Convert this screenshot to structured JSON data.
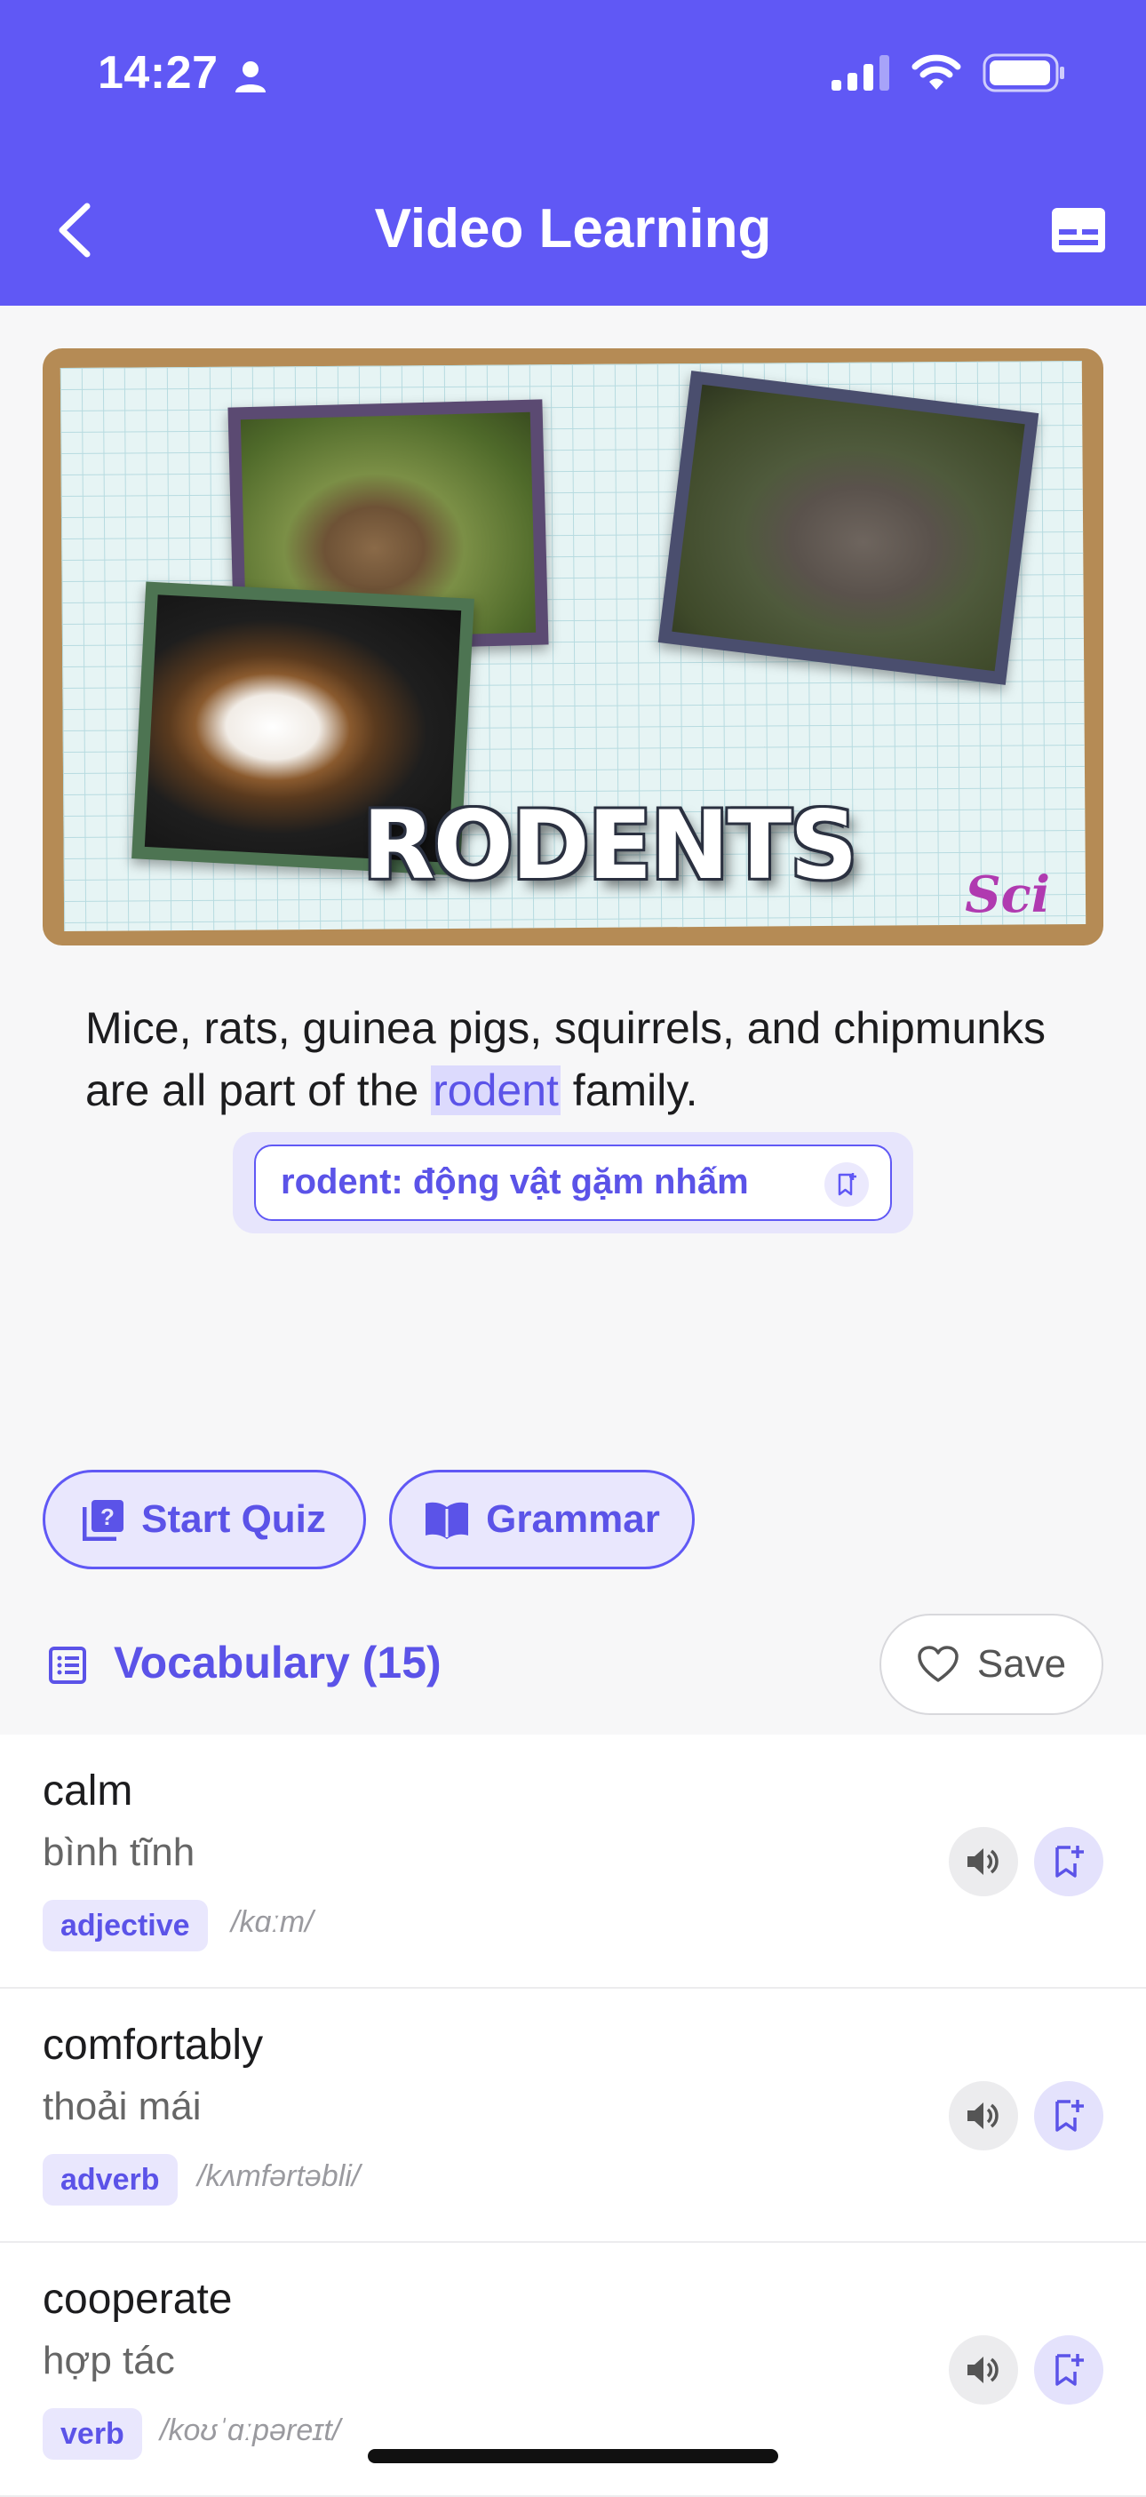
{
  "status": {
    "time": "14:27"
  },
  "header": {
    "title": "Video Learning"
  },
  "video": {
    "title": "RODENTS",
    "logo": "Sci"
  },
  "subtitle": {
    "before": "Mice, rats, guinea pigs, squirrels, and chipmunks are all part of the ",
    "highlight": "rodent",
    "after": " family."
  },
  "translation": {
    "text": "rodent: động vật gặm nhấm"
  },
  "actions": {
    "quiz_label": "Start Quiz",
    "grammar_label": "Grammar"
  },
  "vocabulary": {
    "title": "Vocabulary (15)",
    "save_label": "Save",
    "items": [
      {
        "word": "calm",
        "meaning": "bình tĩnh",
        "pos": "adjective",
        "ipa": "/kɑːm/"
      },
      {
        "word": "comfortably",
        "meaning": "thoải mái",
        "pos": "adverb",
        "ipa": "/kʌmfərtəbli/"
      },
      {
        "word": "cooperate",
        "meaning": "hợp tác",
        "pos": "verb",
        "ipa": "/koʊˈɑːpəreɪt/"
      }
    ]
  },
  "colors": {
    "accent": "#6058f5",
    "accent_light": "#e9e7fd"
  }
}
